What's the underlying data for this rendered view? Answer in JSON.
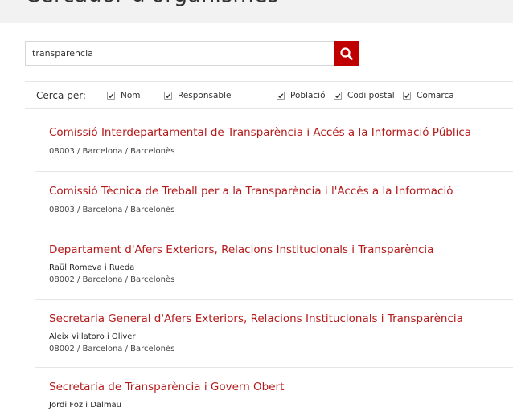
{
  "page": {
    "title": "Cercador d'organismes"
  },
  "search": {
    "value": "transparencia",
    "button_icon": "search-icon"
  },
  "filters": {
    "label": "Cerca per:",
    "options": [
      {
        "label": "Nom",
        "checked": true
      },
      {
        "label": "Responsable",
        "checked": true
      },
      {
        "label": "Població",
        "checked": true
      },
      {
        "label": "Codi postal",
        "checked": true
      },
      {
        "label": "Comarca",
        "checked": true
      }
    ]
  },
  "results": [
    {
      "title": "Comissió Interdepartamental de Transparència i Accés a la Informació Pública",
      "person": "",
      "location": "08003 / Barcelona / Barcelonès"
    },
    {
      "title": "Comissió Tècnica de Treball per a la Transparència i l'Accés a la Informació",
      "person": "",
      "location": "08003 / Barcelona / Barcelonès"
    },
    {
      "title": "Departament d'Afers Exteriors, Relacions Institucionals i Transparència",
      "person": "Raül Romeva i Rueda",
      "location": "08002 / Barcelona / Barcelonès"
    },
    {
      "title": "Secretaria General d'Afers Exteriors, Relacions Institucionals i Transparència",
      "person": "Aleix Villatoro i Oliver",
      "location": "08002 / Barcelona / Barcelonès"
    },
    {
      "title": "Secretaria de Transparència i Govern Obert",
      "person": "Jordi Foz i Dalmau",
      "location": ""
    }
  ],
  "colors": {
    "accent": "#c00000",
    "link": "#b51a1a"
  }
}
